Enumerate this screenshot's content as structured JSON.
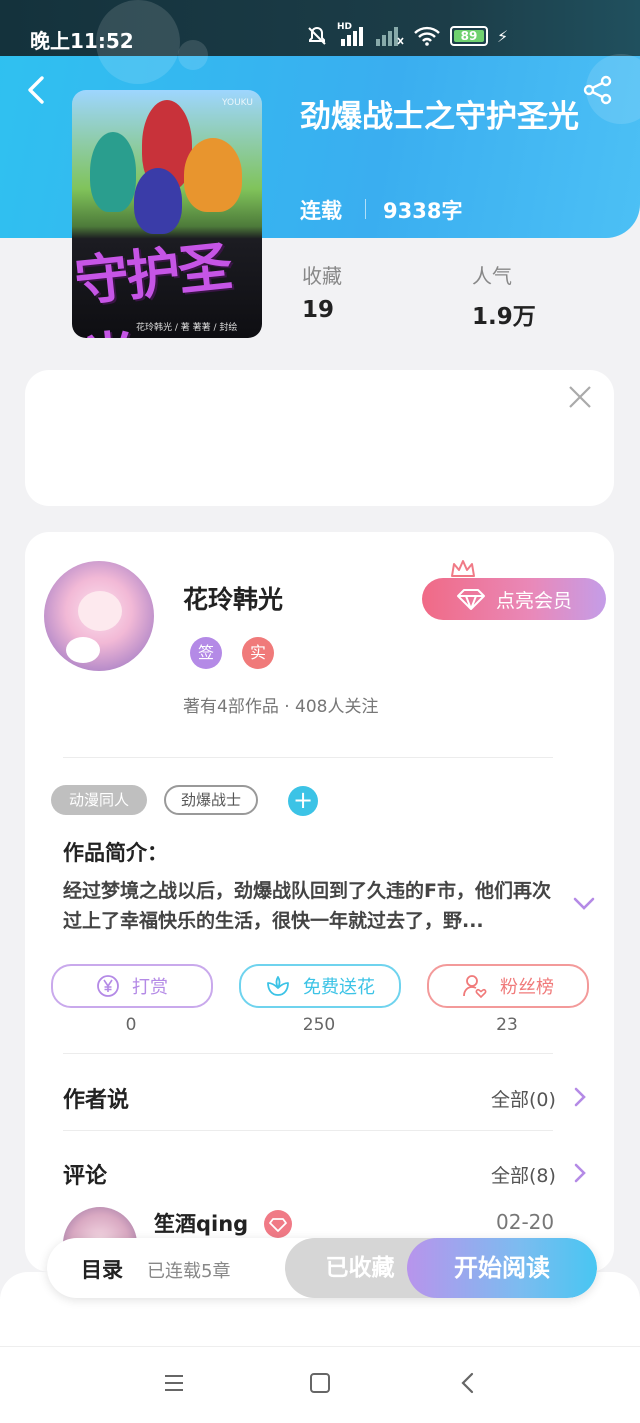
{
  "status_bar": {
    "time": "晚上11:52",
    "signal_label": "HD",
    "battery": "89"
  },
  "book": {
    "title": "劲爆战士之守护圣光",
    "status": "连载",
    "word_count": "9338字",
    "cover_title": "守护圣光",
    "cover_corner": "YOUKU",
    "cover_credits": "花玲韩光 / 著  著著 / 封绘",
    "stats": [
      {
        "label": "收藏",
        "value": "19"
      },
      {
        "label": "人气",
        "value": "1.9万"
      }
    ]
  },
  "author": {
    "name": "花玲韩光",
    "badges": [
      {
        "label": "签",
        "color": "#b48ae6"
      },
      {
        "label": "实",
        "color": "#f07a7a"
      }
    ],
    "meta": "著有4部作品 · 408人关注",
    "vip_button": "点亮会员"
  },
  "tags": [
    "动漫同人",
    "劲爆战士"
  ],
  "intro": {
    "heading": "作品简介：",
    "text": "经过梦境之战以后，劲爆战队回到了久违的F市，他们再次过上了幸福快乐的生活，很快一年就过去了，野..."
  },
  "actions": [
    {
      "label": "打赏",
      "count": "0",
      "color": "#b48ae6"
    },
    {
      "label": "免费送花",
      "count": "250",
      "color": "#3cc3e6"
    },
    {
      "label": "粉丝榜",
      "count": "23",
      "color": "#f07a7a"
    }
  ],
  "author_says": {
    "heading": "作者说",
    "more": "全部(0)"
  },
  "comments": {
    "heading": "评论",
    "more": "全部(8)",
    "first": {
      "user": "笙酒qing",
      "date": "02-20"
    }
  },
  "bottom_bar": {
    "toc_label": "目录",
    "toc_sub": "已连载5章",
    "collected_label": "已收藏",
    "read_label": "开始阅读"
  }
}
